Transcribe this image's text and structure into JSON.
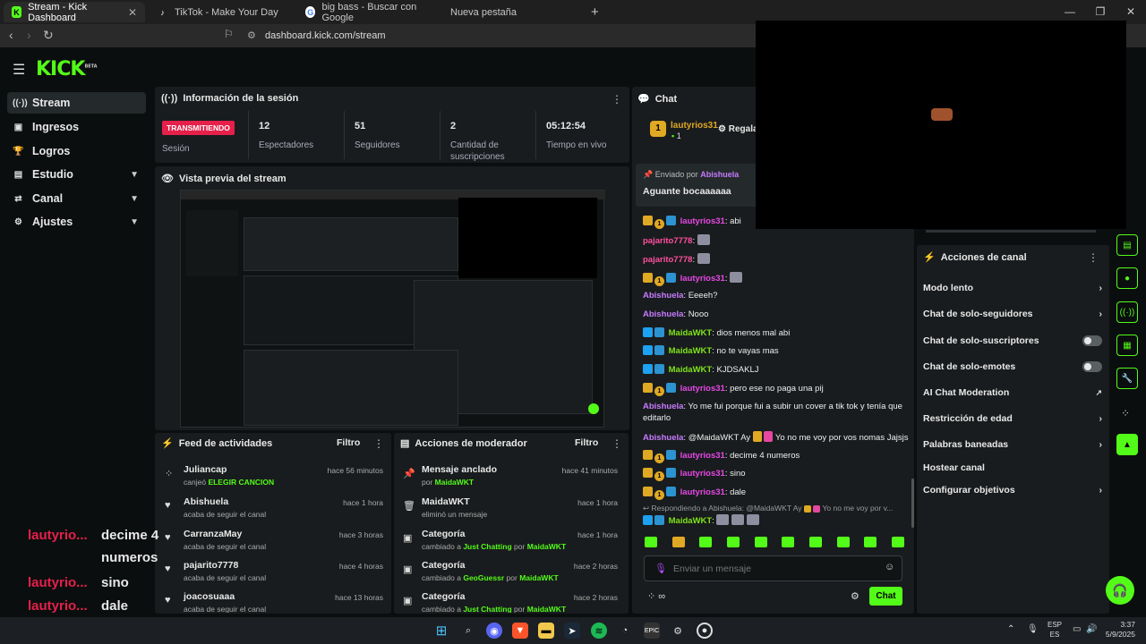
{
  "browser": {
    "tabs": [
      {
        "label": "Stream - Kick Dashboard",
        "active": true
      },
      {
        "label": "TikTok - Make Your Day"
      },
      {
        "label": "big bass - Buscar con Google"
      },
      {
        "label": "Nueva pestaña"
      }
    ],
    "url": "dashboard.kick.com/stream"
  },
  "logo": "KICK",
  "logo_beta": "BETA",
  "sidebar": {
    "items": [
      {
        "label": "Stream"
      },
      {
        "label": "Ingresos"
      },
      {
        "label": "Logros"
      },
      {
        "label": "Estudio"
      },
      {
        "label": "Canal"
      },
      {
        "label": "Ajustes"
      }
    ]
  },
  "session": {
    "title": "Información de la sesión",
    "live_badge": "TRANSMITIENDO",
    "stats": [
      {
        "label": "Sesión",
        "value": ""
      },
      {
        "label": "Espectadores",
        "value": "12"
      },
      {
        "label": "Seguidores",
        "value": "51"
      },
      {
        "label": "Cantidad de suscripciones",
        "value": "2"
      },
      {
        "label": "Tiempo en vivo",
        "value": "05:12:54"
      }
    ]
  },
  "preview": {
    "title": "Vista previa del stream"
  },
  "feed": {
    "title": "Feed de actividades",
    "filter": "Filtro",
    "items": [
      {
        "name": "Juliancap",
        "sub": "canjeó",
        "highlight": "ELEGIR CANCION",
        "time": "hace 56 minutos"
      },
      {
        "name": "Abishuela",
        "sub": "acaba de seguir el canal",
        "time": "hace 1 hora"
      },
      {
        "name": "CarranzaMay",
        "sub": "acaba de seguir el canal",
        "time": "hace 3 horas"
      },
      {
        "name": "pajarito7778",
        "sub": "acaba de seguir el canal",
        "time": "hace 4 horas"
      },
      {
        "name": "joacosuaaa",
        "sub": "acaba de seguir el canal",
        "time": "hace 13 horas"
      }
    ]
  },
  "mod": {
    "title": "Acciones de moderador",
    "filter": "Filtro",
    "items": [
      {
        "name": "Mensaje anclado",
        "sub": "por",
        "highlight": "MaidaWKT",
        "time": "hace 41 minutos"
      },
      {
        "name": "MaidaWKT",
        "sub": "eliminó un mensaje",
        "time": "hace 1 hora"
      },
      {
        "name": "Categoría",
        "sub": "cambiado a",
        "highlight": "Just Chatting",
        "by": "MaidaWKT",
        "time": "hace 1 hora"
      },
      {
        "name": "Categoría",
        "sub": "cambiado a",
        "highlight": "GeoGuessr",
        "by": "MaidaWKT",
        "time": "hace 2 horas"
      },
      {
        "name": "Categoría",
        "sub": "cambiado a",
        "highlight": "Just Chatting",
        "by": "MaidaWKT",
        "time": "hace 2 horas"
      }
    ]
  },
  "chat": {
    "title": "Chat",
    "gifter": {
      "name": "lautyrios31",
      "count": "1",
      "action": "Regala"
    },
    "pinned_by_label": "Enviado por",
    "pinned_by": "Abishuela",
    "pinned_text": "Aguante bocaaaaaa",
    "por": "por",
    "messages": [
      {
        "user": "lautyrios31",
        "text": "abi"
      },
      {
        "user": "pajarito7778",
        "text": ""
      },
      {
        "user": "pajarito7778",
        "text": ""
      },
      {
        "user": "lautyrios31",
        "text": ""
      },
      {
        "user": "Abishuela",
        "text": "Eeeeh?"
      },
      {
        "user": "Abishuela",
        "text": "Nooo"
      },
      {
        "user": "MaidaWKT",
        "text": "dios menos mal abi"
      },
      {
        "user": "MaidaWKT",
        "text": "no te vayas mas"
      },
      {
        "user": "MaidaWKT",
        "text": "KJDSAKLJ"
      },
      {
        "user": "lautyrios31",
        "text": "pero ese no paga una pij"
      },
      {
        "user": "Abishuela",
        "text": "Yo me fui porque fui a subir un cover a tik tok y tenía que editarlo"
      },
      {
        "user": "Abishuela",
        "text": "@MaidaWKT Ay",
        "text2": "Yo no me voy por vos nomas Jajsjs"
      },
      {
        "user": "lautyrios31",
        "text": "decime 4 numeros"
      },
      {
        "user": "lautyrios31",
        "text": "sino"
      },
      {
        "user": "lautyrios31",
        "text": "dale"
      }
    ],
    "reply_to": "Respondiendo a Abishuela: @MaidaWKT Ay",
    "reply_to2": "Yo no me voy por v...",
    "reply_user": "MaidaWKT",
    "input_placeholder": "Enviar un mensaje",
    "send_label": "Chat"
  },
  "channel_actions": {
    "title": "Acciones de canal",
    "items": [
      {
        "label": "Modo lento",
        "control": "chevron"
      },
      {
        "label": "Chat de solo-seguidores",
        "control": "chevron"
      },
      {
        "label": "Chat de solo-suscriptores",
        "control": "toggle"
      },
      {
        "label": "Chat de solo-emotes",
        "control": "toggle"
      },
      {
        "label": "AI Chat Moderation",
        "control": "external"
      },
      {
        "label": "Restricción de edad",
        "control": "chevron"
      },
      {
        "label": "Palabras baneadas",
        "control": "chevron"
      },
      {
        "label": "Hostear canal",
        "control": "none"
      },
      {
        "label": "Configurar objetivos",
        "control": "chevron"
      }
    ]
  },
  "overlay": {
    "lines": [
      {
        "user": "lautyrio...",
        "text": "decime 4"
      },
      {
        "user": "",
        "text": "numeros"
      },
      {
        "user": "lautyrio...",
        "text": "sino"
      },
      {
        "user": "lautyrio...",
        "text": "dale"
      }
    ]
  },
  "taskbar": {
    "lang": "ESP",
    "lang2": "ES",
    "time": "3:37",
    "date": "5/9/2025"
  },
  "colors": {
    "accent": "#53fc18",
    "live": "#e5204b"
  }
}
